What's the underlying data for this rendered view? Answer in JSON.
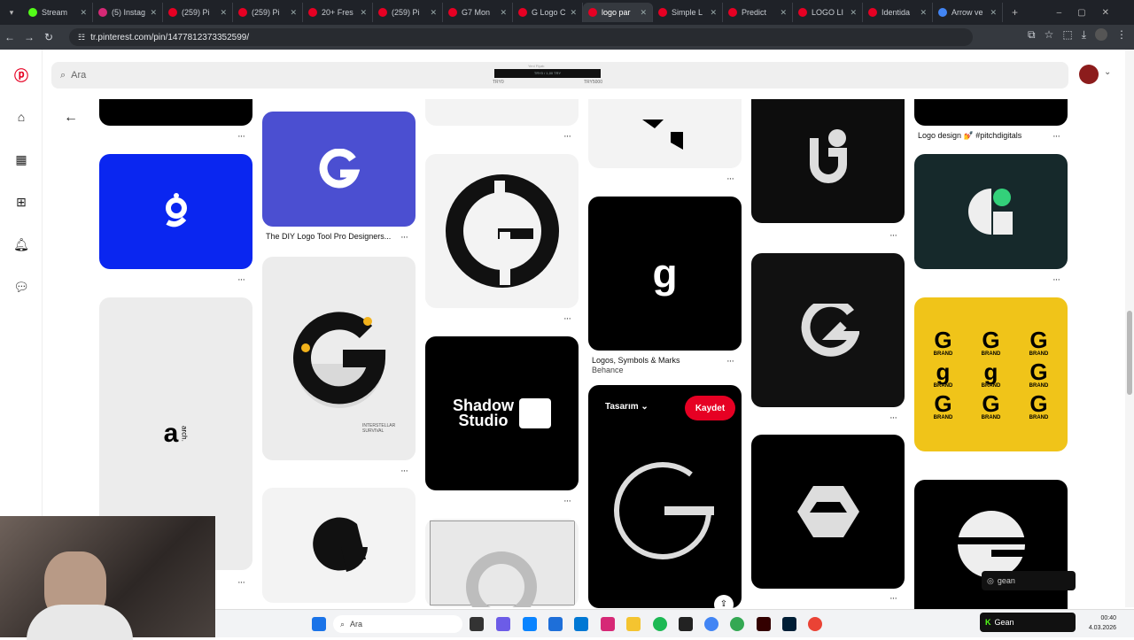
{
  "browser": {
    "tabs": [
      {
        "label": "Stream",
        "color": "#53fc18"
      },
      {
        "label": "(5) Instag",
        "color": "#d62976"
      },
      {
        "label": "(259) Pi",
        "color": "#e60023"
      },
      {
        "label": "(259) Pi",
        "color": "#e60023"
      },
      {
        "label": "20+ Fres",
        "color": "#e60023"
      },
      {
        "label": "(259) Pi",
        "color": "#e60023"
      },
      {
        "label": "G7 Mon",
        "color": "#e60023"
      },
      {
        "label": "G Logo C",
        "color": "#e60023"
      },
      {
        "label": "logo par",
        "color": "#e60023"
      },
      {
        "label": "Simple L",
        "color": "#e60023"
      },
      {
        "label": "Predict",
        "color": "#e60023"
      },
      {
        "label": "LOGO LI",
        "color": "#e60023"
      },
      {
        "label": "Identida",
        "color": "#e60023"
      },
      {
        "label": "Arrow ve",
        "color": "#4285f4"
      }
    ],
    "active_tab_index": 8,
    "url": "tr.pinterest.com/pin/1477812373352599/"
  },
  "header": {
    "search_placeholder": "Ara",
    "ad_min": "TRY0",
    "ad_max": "TRY5000",
    "ad_top": "Yeni Fiyatı",
    "ad_mid": "TRY0 / 1,00 TRY"
  },
  "pins": {
    "caption_diy": "The DIY Logo Tool Pro Designers...",
    "caption_logos": "Logos, Symbols & Marks",
    "caption_behance": "Behance",
    "caption_pitch": "Logo design 💅 #pitchdigitals",
    "shadow_text1": "Shadow",
    "shadow_text2": "Studio",
    "brand_word": "BRAND",
    "arch_label": "arch.",
    "tasarim": "Tasarım",
    "kaydet": "Kaydet",
    "interstellar": "INTERSTELLAR SURVIVAL"
  },
  "taskbar": {
    "search": "Ara",
    "time": "00:40",
    "date": "4.03.2026"
  },
  "overlays": {
    "kick_label": "Gean",
    "ig_label": "gean"
  }
}
